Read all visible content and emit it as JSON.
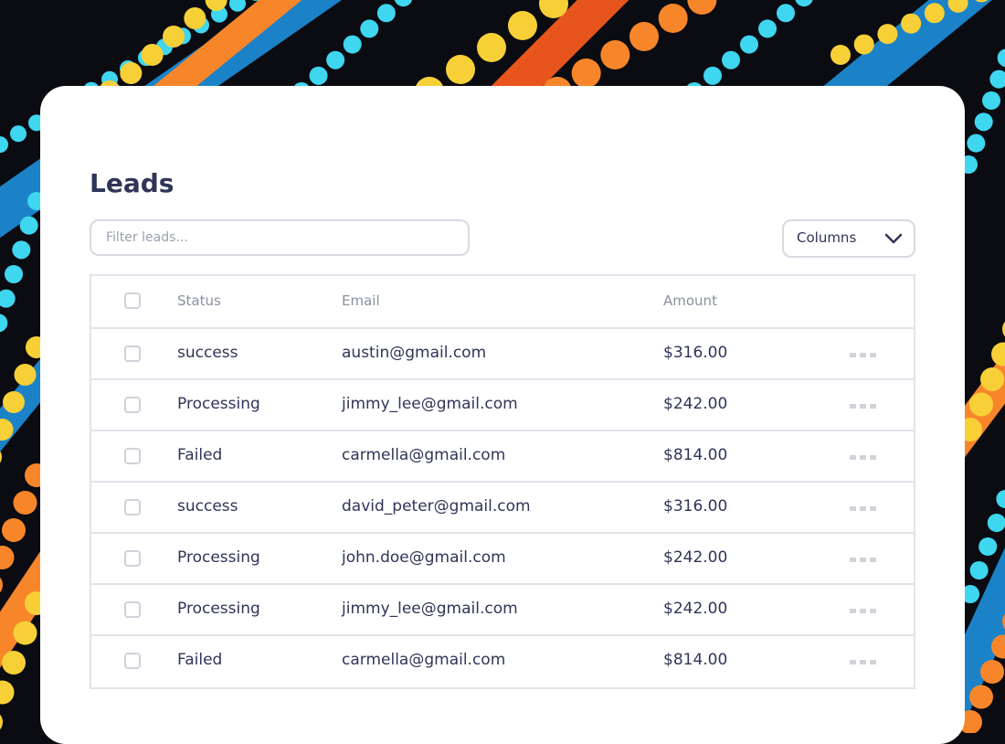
{
  "page": {
    "title": "Leads"
  },
  "filter": {
    "placeholder": "Filter leads..."
  },
  "columns_button": {
    "label": "Columns"
  },
  "table": {
    "headers": {
      "status": "Status",
      "email": "Email",
      "amount": "Amount"
    },
    "rows": [
      {
        "status": "success",
        "email": "austin@gmail.com",
        "amount": "$316.00"
      },
      {
        "status": "Processing",
        "email": "jimmy_lee@gmail.com",
        "amount": "$242.00"
      },
      {
        "status": "Failed",
        "email": "carmella@gmail.com",
        "amount": "$814.00"
      },
      {
        "status": "success",
        "email": "david_peter@gmail.com",
        "amount": "$316.00"
      },
      {
        "status": "Processing",
        "email": "john.doe@gmail.com",
        "amount": "$242.00"
      },
      {
        "status": "Processing",
        "email": "jimmy_lee@gmail.com",
        "amount": "$242.00"
      },
      {
        "status": "Failed",
        "email": "carmella@gmail.com",
        "amount": "$814.00"
      }
    ]
  },
  "icons": {
    "dropdown": "chevron-down-icon",
    "row_actions": "more-horizontal-icon"
  },
  "colors": {
    "text_primary": "#2f3558",
    "text_muted": "#8b90a1",
    "border": "#e2e4ea",
    "card_background": "#ffffff",
    "backdrop_palette": [
      "#1b82c8",
      "#3fd6f0",
      "#f7d038",
      "#f7862a",
      "#e8551c",
      "#0b0b12"
    ]
  }
}
